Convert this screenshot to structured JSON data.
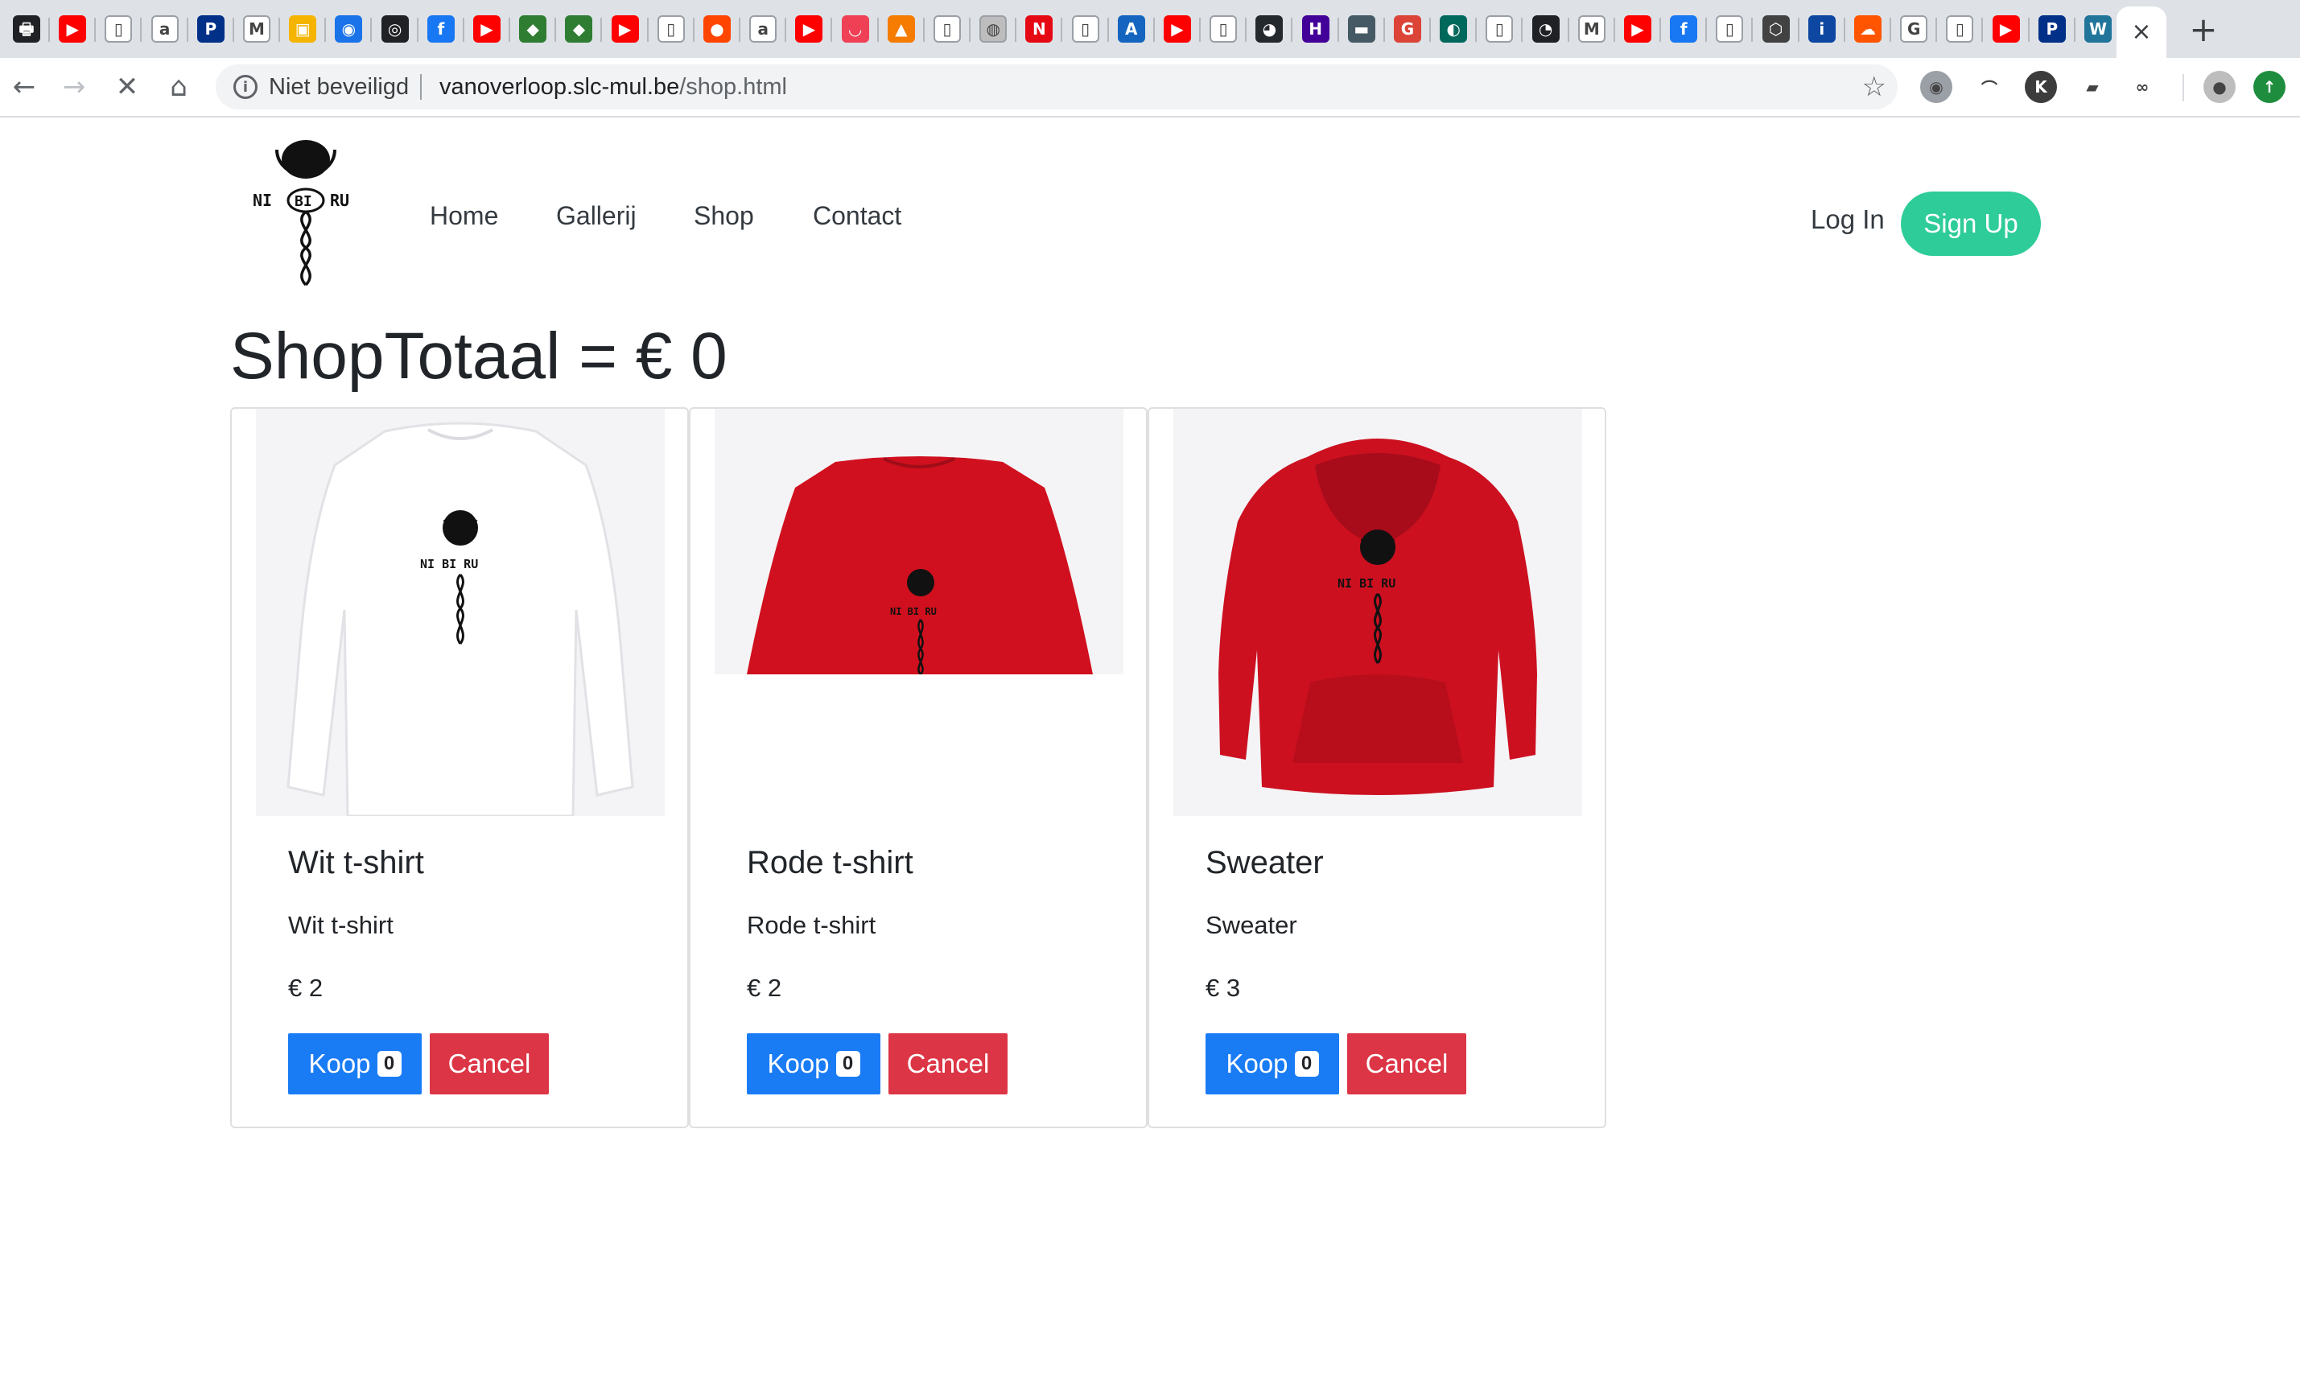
{
  "browser": {
    "tabs_favicons": [
      {
        "icon": "printer-icon",
        "color": "#202124",
        "glyph": "🖶"
      },
      {
        "icon": "youtube-icon",
        "color": "#ff0000",
        "glyph": "▶"
      },
      {
        "icon": "page-icon",
        "color": "#ffffff",
        "glyph": "▯"
      },
      {
        "icon": "amazon-a-icon",
        "color": "#ffffff",
        "glyph": "a"
      },
      {
        "icon": "paypal-icon",
        "color": "#003087",
        "glyph": "P"
      },
      {
        "icon": "gmail-icon",
        "color": "#ffffff",
        "glyph": "M"
      },
      {
        "icon": "photos-icon",
        "color": "#f4b400",
        "glyph": "▣"
      },
      {
        "icon": "contacts-icon",
        "color": "#1a73e8",
        "glyph": "◉"
      },
      {
        "icon": "circle-icon",
        "color": "#202124",
        "glyph": "◎"
      },
      {
        "icon": "facebook-icon",
        "color": "#1877f2",
        "glyph": "f"
      },
      {
        "icon": "youtube-icon",
        "color": "#ff0000",
        "glyph": "▶"
      },
      {
        "icon": "game-icon",
        "color": "#2e7d32",
        "glyph": "◆"
      },
      {
        "icon": "game-icon",
        "color": "#2e7d32",
        "glyph": "◆"
      },
      {
        "icon": "youtube-icon",
        "color": "#ff0000",
        "glyph": "▶"
      },
      {
        "icon": "page-icon",
        "color": "#ffffff",
        "glyph": "▯"
      },
      {
        "icon": "reddit-icon",
        "color": "#ff4500",
        "glyph": "●"
      },
      {
        "icon": "amazon-icon",
        "color": "#ffffff",
        "glyph": "a"
      },
      {
        "icon": "youtube-icon",
        "color": "#ff0000",
        "glyph": "▶"
      },
      {
        "icon": "pocket-icon",
        "color": "#ef4056",
        "glyph": "◡"
      },
      {
        "icon": "pma-icon",
        "color": "#f57c00",
        "glyph": "▲"
      },
      {
        "icon": "page-icon",
        "color": "#ffffff",
        "glyph": "▯"
      },
      {
        "icon": "globe-icon",
        "color": "#bdbdbd",
        "glyph": "◍"
      },
      {
        "icon": "netflix-icon",
        "color": "#e50914",
        "glyph": "N"
      },
      {
        "icon": "page-icon",
        "color": "#ffffff",
        "glyph": "▯"
      },
      {
        "icon": "air-icon",
        "color": "#1565c0",
        "glyph": "A"
      },
      {
        "icon": "youtube-icon",
        "color": "#ff0000",
        "glyph": "▶"
      },
      {
        "icon": "page-icon",
        "color": "#ffffff",
        "glyph": "▯"
      },
      {
        "icon": "github-icon",
        "color": "#24292e",
        "glyph": "◕"
      },
      {
        "icon": "heroku-icon",
        "color": "#430098",
        "glyph": "H"
      },
      {
        "icon": "folder-icon",
        "color": "#455a64",
        "glyph": "▬"
      },
      {
        "icon": "google-plus-icon",
        "color": "#db4437",
        "glyph": "G"
      },
      {
        "icon": "terminal-icon",
        "color": "#00695c",
        "glyph": "◐"
      },
      {
        "icon": "page-icon",
        "color": "#ffffff",
        "glyph": "▯"
      },
      {
        "icon": "spiral-icon",
        "color": "#202124",
        "glyph": "◔"
      },
      {
        "icon": "gmail-icon",
        "color": "#ffffff",
        "glyph": "M"
      },
      {
        "icon": "youtube-icon",
        "color": "#ff0000",
        "glyph": "▶"
      },
      {
        "icon": "facebook-icon",
        "color": "#1877f2",
        "glyph": "f"
      },
      {
        "icon": "page-icon",
        "color": "#ffffff",
        "glyph": "▯"
      },
      {
        "icon": "cube-icon",
        "color": "#424242",
        "glyph": "⬡"
      },
      {
        "icon": "info-icon",
        "color": "#0d47a1",
        "glyph": "i"
      },
      {
        "icon": "soundcloud-icon",
        "color": "#ff5500",
        "glyph": "☁"
      },
      {
        "icon": "google-icon",
        "color": "#ffffff",
        "glyph": "G"
      },
      {
        "icon": "page-icon",
        "color": "#ffffff",
        "glyph": "▯"
      },
      {
        "icon": "youtube-icon",
        "color": "#ff0000",
        "glyph": "▶"
      },
      {
        "icon": "paypal-icon",
        "color": "#003087",
        "glyph": "P"
      },
      {
        "icon": "wordpress-icon",
        "color": "#21759b",
        "glyph": "W"
      }
    ],
    "active_tab_close": "×",
    "new_tab": "+",
    "nav": {
      "back": "←",
      "forward": "→",
      "stop": "✕",
      "home": "⌂"
    },
    "omnibox": {
      "security_label": "Niet beveiligd",
      "url_host": "vanoverloop.slc-mul.be",
      "url_path": "/shop.html",
      "star": "☆"
    },
    "extensions": [
      {
        "icon": "discord-icon",
        "color": "#9aa0a6",
        "glyph": "◉"
      },
      {
        "icon": "rainbow-icon",
        "color": "#ffffff",
        "glyph": "⌒"
      },
      {
        "icon": "k-icon",
        "color": "#3c3c3c",
        "glyph": "K"
      },
      {
        "icon": "graduation-icon",
        "color": "#ffffff",
        "glyph": "▰"
      },
      {
        "icon": "bike-icon",
        "color": "#ffffff",
        "glyph": "∞"
      },
      {
        "icon": "profile-icon",
        "color": "#bdbdbd",
        "glyph": "●"
      },
      {
        "icon": "update-icon",
        "color": "#1e8e3e",
        "glyph": "↑"
      }
    ]
  },
  "site": {
    "logo_text": "NI BI RU",
    "nav": [
      "Home",
      "Gallerij",
      "Shop",
      "Contact"
    ],
    "login": "Log In",
    "signup": "Sign Up"
  },
  "shop": {
    "total_label": "ShopTotaal = € 0",
    "products": [
      {
        "title": "Wit t-shirt",
        "description": "Wit t-shirt",
        "price": "€ 2",
        "buy_label": "Koop",
        "count": "0",
        "cancel_label": "Cancel",
        "image": "white-longsleeve-shirt-image",
        "garment_color": "#ffffff"
      },
      {
        "title": "Rode t-shirt",
        "description": "Rode t-shirt",
        "price": "€ 2",
        "buy_label": "Koop",
        "count": "0",
        "cancel_label": "Cancel",
        "image": "red-longsleeve-shirt-image",
        "garment_color": "#d0101e"
      },
      {
        "title": "Sweater",
        "description": "Sweater",
        "price": "€ 3",
        "buy_label": "Koop",
        "count": "0",
        "cancel_label": "Cancel",
        "image": "red-hoodie-image",
        "garment_color": "#cc1020"
      }
    ]
  },
  "colors": {
    "primary": "#1a7cf5",
    "danger": "#dc3545",
    "accent": "#2ecc98"
  }
}
